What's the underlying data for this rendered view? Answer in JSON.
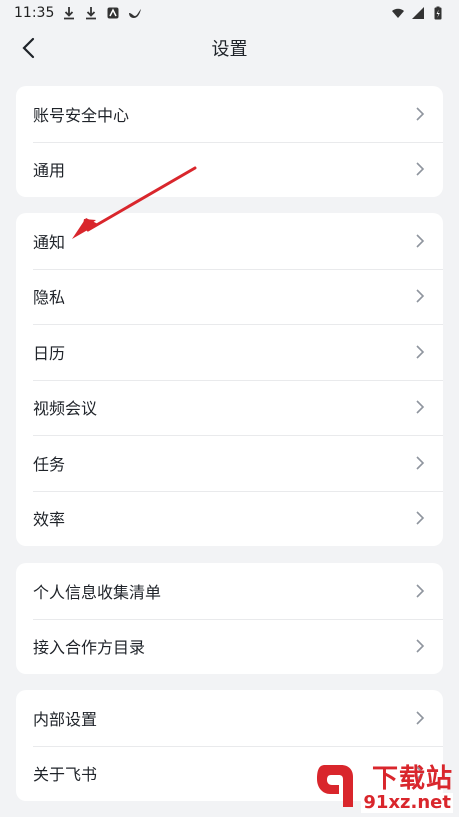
{
  "status": {
    "time": "11:35"
  },
  "nav": {
    "title": "设置"
  },
  "groups": [
    {
      "items": [
        "账号安全中心",
        "通用"
      ]
    },
    {
      "items": [
        "通知",
        "隐私",
        "日历",
        "视频会议",
        "任务",
        "效率"
      ]
    },
    {
      "items": [
        "个人信息收集清单",
        "接入合作方目录"
      ]
    },
    {
      "items": [
        "内部设置",
        "关于飞书"
      ]
    }
  ],
  "watermark": {
    "brand": "下载站",
    "domain": "91xz.net"
  },
  "colors": {
    "background": "#f2f3f5",
    "card": "#ffffff",
    "accent_arrow": "#d9262c",
    "text": "#1f2329",
    "chevron": "#8f959e"
  }
}
